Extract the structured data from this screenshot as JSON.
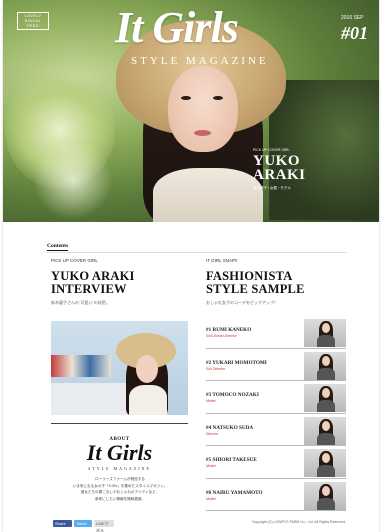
{
  "hero": {
    "tag_lines": [
      "LOVELY",
      "SOCIAL",
      "FEED"
    ],
    "logo": "It Girls",
    "subtitle": "STYLE MAGAZINE",
    "issue_label": "2016 SEP",
    "issue_number": "#01",
    "cover_small": "PICK UP COVER GIRL",
    "cover_name_line1": "YUKO",
    "cover_name_line2": "ARAKI",
    "cover_meta": "新木優子 / 女優・モデル"
  },
  "contents": {
    "heading": "Contents",
    "interview": {
      "label": "PICK UP COVER GIRL",
      "title_line1": "YUKO ARAKI",
      "title_line2": "INTERVIEW",
      "subtitle_jp": "新木優子さんの\"可愛い\"の秘密。"
    },
    "about": {
      "label": "ABOUT",
      "logo": "It Girls",
      "sub": "STYLE MAGAZINE",
      "text_lines": [
        "ローリーズファームが発信する",
        "いま気になる女の子「It Girl」を集めたスタイルマガジン。",
        "彼女たちの着こなしやおしゃれのアイディなど、",
        "参考にしたい情報を随時更新。"
      ]
    },
    "share": {
      "facebook": "Share",
      "twitter": "Tweet",
      "line": "LINEで送る"
    },
    "fashionista": {
      "label": "IT GIRL SNAP!!",
      "title_line1": "FASHIONISTA",
      "title_line2": "STYLE SAMPLE",
      "subtitle_jp": "おしゃれ女子のコーデをピックアップ！",
      "items": [
        {
          "name": "#1 RUMI KANEKO",
          "role": "SNS Brand Director"
        },
        {
          "name": "#2 YUKARI MOMOTOMI",
          "role": "Sns Director"
        },
        {
          "name": "#3 TOMOCO NOZAKI",
          "role": "Model"
        },
        {
          "name": "#4 NATSUKO SUDA",
          "role": "Director"
        },
        {
          "name": "#5 SHIORI TAKESUE",
          "role": "Model"
        },
        {
          "name": "#6 NAIRU YAMAMOTO",
          "role": "Model"
        }
      ]
    }
  },
  "footer": "Copyright (C) LOWRYS FARM Co., Ltd. All Rights Reserved."
}
